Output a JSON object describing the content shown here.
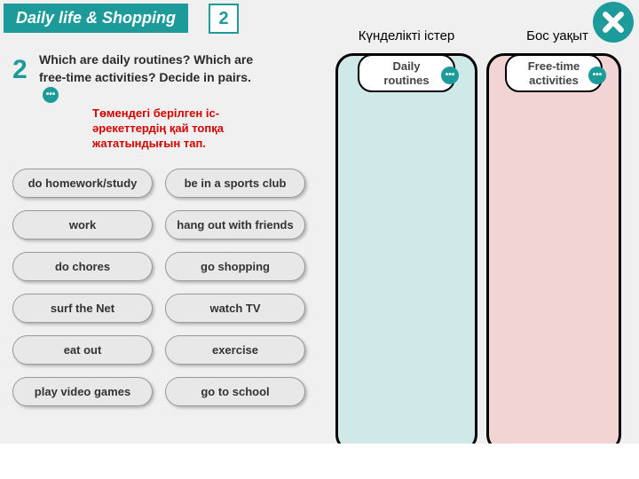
{
  "header": {
    "title": "Daily life & Shopping",
    "unit_number": "2"
  },
  "question": {
    "number": "2",
    "text": "Which are daily routines? Which are free-time activities? Decide in pairs.",
    "dots": "•••"
  },
  "instruction": "Төмендегі берілген іс-әрекеттердің қай топқа жататындығын тап.",
  "items": [
    "do homework/study",
    "be in a sports club",
    "work",
    "hang out with friends",
    "do chores",
    "go shopping",
    "surf the Net",
    "watch TV",
    "eat out",
    "exercise",
    "play video games",
    "go to school"
  ],
  "drop_zones": {
    "zone1": {
      "label_top": "Күнделікті істер",
      "header": "Daily routines"
    },
    "zone2": {
      "label_top": "Бос уақыт",
      "header": "Free-time activities"
    }
  }
}
